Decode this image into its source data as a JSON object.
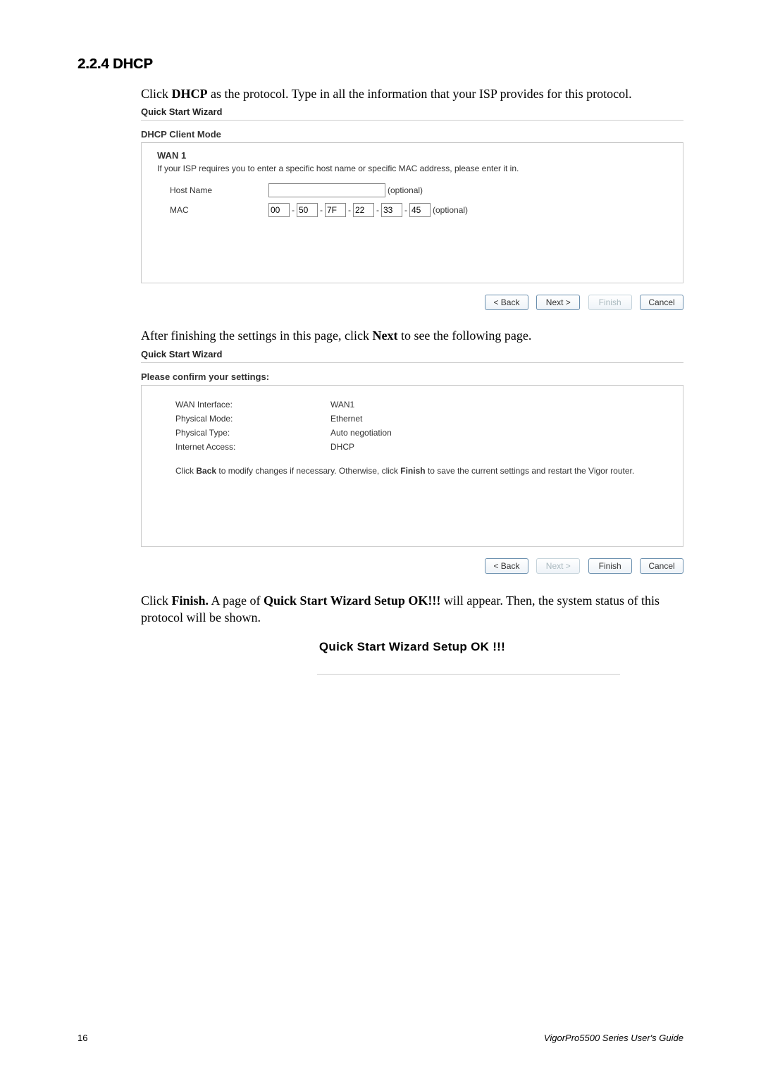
{
  "section": {
    "number": "2.2.4",
    "title": "DHCP"
  },
  "intro1_a": "Click ",
  "intro1_b": "DHCP",
  "intro1_c": " as the protocol. Type in all the information that your ISP provides for this protocol.",
  "qsw_title": "Quick Start Wizard",
  "panel1": {
    "heading": "DHCP Client Mode",
    "wan_title": "WAN 1",
    "desc": "If your ISP requires you to enter a specific host name or specific MAC address, please enter it in.",
    "host_label": "Host Name",
    "host_value": "",
    "host_hint": "(optional)",
    "mac_label": "MAC",
    "mac": [
      "00",
      "50",
      "7F",
      "22",
      "33",
      "45"
    ],
    "mac_hint": "(optional)"
  },
  "buttons": {
    "back": "< Back",
    "next": "Next >",
    "finish": "Finish",
    "cancel": "Cancel"
  },
  "mid_text_a": "After finishing the settings in this page, click ",
  "mid_text_b": "Next",
  "mid_text_c": " to see the following page.",
  "panel2": {
    "heading": "Please confirm your settings:",
    "rows": [
      {
        "label": "WAN Interface:",
        "value": "WAN1"
      },
      {
        "label": "Physical Mode:",
        "value": "Ethernet"
      },
      {
        "label": "Physical Type:",
        "value": "Auto negotiation"
      },
      {
        "label": "Internet Access:",
        "value": "DHCP"
      }
    ],
    "note_a": "Click ",
    "note_b": "Back",
    "note_c": " to modify changes if necessary. Otherwise, click ",
    "note_d": "Finish",
    "note_e": " to save the current settings and restart the Vigor router."
  },
  "outro_a": "Click ",
  "outro_b": "Finish.",
  "outro_c": " A page of ",
  "outro_d": "Quick Start Wizard Setup OK!!!",
  "outro_e": " will appear. Then, the system status of this protocol will be shown.",
  "setup_ok": "Quick Start Wizard Setup OK !!!",
  "footer": {
    "page": "16",
    "guide": "VigorPro5500  Series  User's Guide"
  }
}
